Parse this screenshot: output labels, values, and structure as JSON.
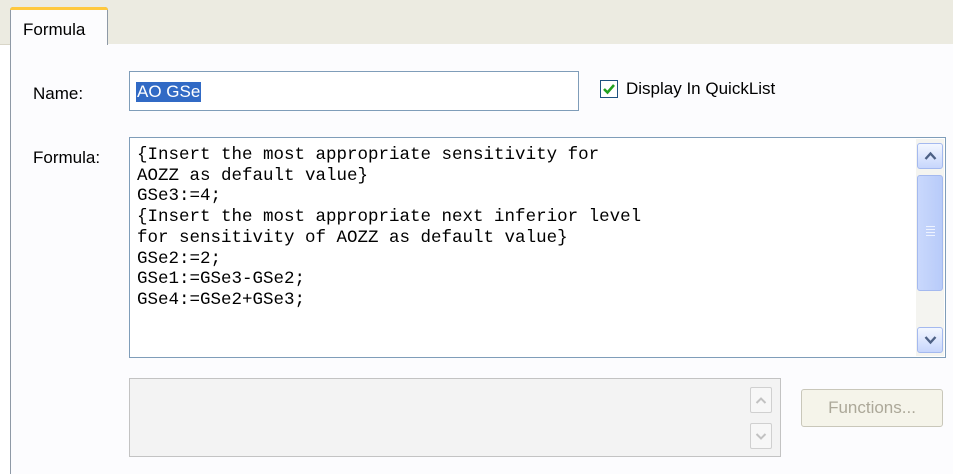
{
  "tabs": [
    {
      "label": "Formula",
      "active": true
    }
  ],
  "form": {
    "name_label": "Name:",
    "name_value": "AO GSe",
    "display_quicklist_label": "Display In QuickList",
    "display_quicklist_checked": true,
    "formula_label": "Formula:",
    "formula_lines": [
      "{Insert the most appropriate sensitivity for",
      "AOZZ as default value}",
      "GSe3:=4;",
      "{Insert the most appropriate next inferior level",
      "for sensitivity of AOZZ as default value}",
      "GSe2:=2;",
      "GSe1:=GSe3-GSe2;",
      "GSe4:=GSe2+GSe3;"
    ],
    "functions_button": "Functions..."
  },
  "colors": {
    "tab_highlight": "#ffc83c",
    "selection": "#316ac5",
    "checkmark": "#21a121",
    "input_border": "#7f9db9"
  },
  "icons": {
    "scroll_up": "chevron-up-icon",
    "scroll_down": "chevron-down-icon",
    "check": "checkmark-icon"
  }
}
